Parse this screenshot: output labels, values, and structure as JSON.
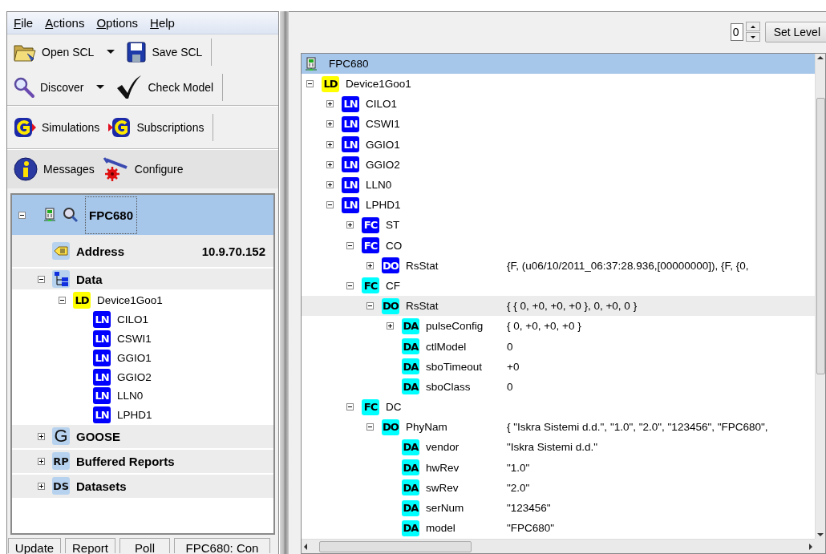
{
  "menu": [
    {
      "label": "File"
    },
    {
      "label": "Actions"
    },
    {
      "label": "Options"
    },
    {
      "label": "Help"
    }
  ],
  "toolbars": [
    {
      "items": [
        {
          "label": "Open SCL",
          "dropdown": true
        },
        {
          "label": "Save SCL",
          "dropdown": false
        }
      ]
    },
    {
      "items": [
        {
          "label": "Discover",
          "dropdown": true
        },
        {
          "label": "Check Model",
          "dropdown": false
        }
      ]
    },
    {
      "items": [
        {
          "label": "Simulations",
          "dropdown": false
        },
        {
          "label": "Subscriptions",
          "dropdown": false
        }
      ]
    },
    {
      "items": [
        {
          "label": "Messages",
          "dropdown": false
        },
        {
          "label": "Configure",
          "dropdown": false
        }
      ]
    }
  ],
  "left_tree": {
    "root": {
      "label": "FPC680",
      "selected": true,
      "expanded": true
    },
    "items": [
      {
        "kind": "address",
        "label": "Address",
        "value": "10.9.70.152"
      },
      {
        "kind": "data",
        "label": "Data",
        "expanded": true,
        "children": [
          {
            "badge": "LD",
            "color": "#ffff00",
            "label": "Device1Goo1",
            "expanded": true,
            "children": [
              {
                "badge": "LN",
                "color": "#0000ff",
                "label": "CILO1"
              },
              {
                "badge": "LN",
                "color": "#0000ff",
                "label": "CSWI1"
              },
              {
                "badge": "LN",
                "color": "#0000ff",
                "label": "GGIO1"
              },
              {
                "badge": "LN",
                "color": "#0000ff",
                "label": "GGIO2"
              },
              {
                "badge": "LN",
                "color": "#0000ff",
                "label": "LLN0"
              },
              {
                "badge": "LN",
                "color": "#0000ff",
                "label": "LPHD1"
              }
            ]
          }
        ]
      },
      {
        "kind": "goose",
        "badge": "G",
        "label": "GOOSE",
        "expanded": false
      },
      {
        "kind": "reports",
        "badge": "RP",
        "label": "Buffered Reports",
        "expanded": false
      },
      {
        "kind": "datasets",
        "badge": "DS",
        "label": "Datasets",
        "expanded": false
      }
    ]
  },
  "status_bar": [
    "Update",
    "Report",
    "Poll",
    "FPC680: Con"
  ],
  "level_spinner": {
    "value": "0"
  },
  "set_level_button": "Set Level",
  "detail_tree": {
    "root": {
      "label": "FPC680",
      "selected": true
    },
    "nodes": [
      {
        "badge": "LD",
        "color": "#ffff00",
        "name": "Device1Goo1",
        "expanded": true,
        "selected": false,
        "children": [
          {
            "badge": "LN",
            "color": "#0000ff",
            "name": "CILO1",
            "expanded": false,
            "selected": false
          },
          {
            "badge": "LN",
            "color": "#0000ff",
            "name": "CSWI1",
            "expanded": false,
            "selected": false
          },
          {
            "badge": "LN",
            "color": "#0000ff",
            "name": "GGIO1",
            "expanded": false,
            "selected": false
          },
          {
            "badge": "LN",
            "color": "#0000ff",
            "name": "GGIO2",
            "expanded": false,
            "selected": false
          },
          {
            "badge": "LN",
            "color": "#0000ff",
            "name": "LLN0",
            "expanded": false,
            "selected": false
          },
          {
            "badge": "LN",
            "color": "#0000ff",
            "name": "LPHD1",
            "expanded": true,
            "selected": false,
            "children": [
              {
                "badge": "FC",
                "color": "#0000ff",
                "name": "ST",
                "expanded": false,
                "selected": false
              },
              {
                "badge": "FC",
                "color": "#0000ff",
                "name": "CO",
                "expanded": true,
                "selected": false,
                "children": [
                  {
                    "badge": "DO",
                    "color": "#0000ff",
                    "name": "RsStat",
                    "value": "{F, (u06/10/2011_06:37:28.936,[00000000]), {F, {0,",
                    "expanded": false,
                    "selected": false
                  }
                ]
              },
              {
                "badge": "FC",
                "color": "#00ffff",
                "name": "CF",
                "expanded": true,
                "selected": false,
                "children": [
                  {
                    "badge": "DO",
                    "color": "#00ffff",
                    "name": "RsStat",
                    "value": "{ { 0, +0, +0, +0 }, 0, +0, 0 }",
                    "expanded": true,
                    "selected": true,
                    "children": [
                      {
                        "badge": "DA",
                        "color": "#00ffff",
                        "name": "pulseConfig",
                        "value": "{ 0, +0, +0, +0 }",
                        "expanded": false,
                        "selected": false
                      },
                      {
                        "badge": "DA",
                        "color": "#00ffff",
                        "name": "ctlModel",
                        "value": "0",
                        "selected": false
                      },
                      {
                        "badge": "DA",
                        "color": "#00ffff",
                        "name": "sboTimeout",
                        "value": "+0",
                        "selected": false
                      },
                      {
                        "badge": "DA",
                        "color": "#00ffff",
                        "name": "sboClass",
                        "value": "0",
                        "selected": false
                      }
                    ]
                  }
                ]
              },
              {
                "badge": "FC",
                "color": "#00ffff",
                "name": "DC",
                "expanded": true,
                "selected": false,
                "children": [
                  {
                    "badge": "DO",
                    "color": "#00ffff",
                    "name": "PhyNam",
                    "value": "{ \"Iskra Sistemi d.d.\", \"1.0\", \"2.0\", \"123456\", \"FPC680\",",
                    "expanded": true,
                    "selected": false,
                    "children": [
                      {
                        "badge": "DA",
                        "color": "#00ffff",
                        "name": "vendor",
                        "value": "\"Iskra Sistemi d.d.\"",
                        "selected": false
                      },
                      {
                        "badge": "DA",
                        "color": "#00ffff",
                        "name": "hwRev",
                        "value": "\"1.0\"",
                        "selected": false
                      },
                      {
                        "badge": "DA",
                        "color": "#00ffff",
                        "name": "swRev",
                        "value": "\"2.0\"",
                        "selected": false
                      },
                      {
                        "badge": "DA",
                        "color": "#00ffff",
                        "name": "serNum",
                        "value": "\"123456\"",
                        "selected": false
                      },
                      {
                        "badge": "DA",
                        "color": "#00ffff",
                        "name": "model",
                        "value": "\"FPC680\"",
                        "selected": false
                      }
                    ]
                  }
                ]
              }
            ]
          }
        ]
      }
    ]
  }
}
